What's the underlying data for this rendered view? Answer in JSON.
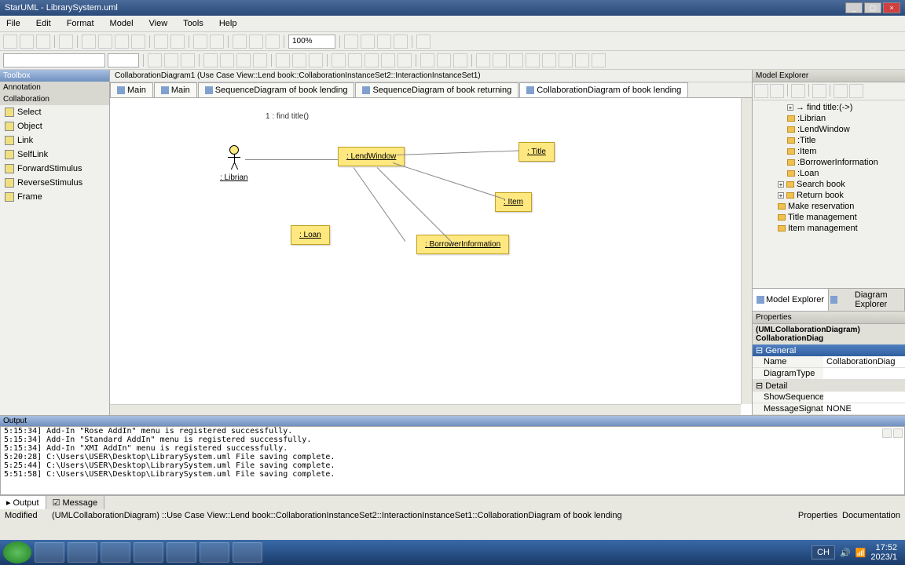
{
  "window": {
    "title": "StarUML - LibrarySystem.uml"
  },
  "menu": {
    "file": "File",
    "edit": "Edit",
    "format": "Format",
    "model": "Model",
    "view": "View",
    "tools": "Tools",
    "help": "Help"
  },
  "toolbar2": {
    "zoom": "100%"
  },
  "toolbox": {
    "title": "Toolbox",
    "groups": {
      "annotation": "Annotation",
      "collaboration": "Collaboration"
    },
    "items": {
      "select": "Select",
      "object": "Object",
      "link": "Link",
      "selflink": "SelfLink",
      "forward": "ForwardStimulus",
      "reverse": "ReverseStimulus",
      "frame": "Frame"
    }
  },
  "breadcrumb": "CollaborationDiagram1 (Use Case View::Lend book::CollaborationInstanceSet2::InteractionInstanceSet1)",
  "tabs": {
    "main1": "Main",
    "main2": "Main",
    "seq1": "SequenceDiagram of book lending",
    "seq2": "SequenceDiagram of book returning",
    "collab": "CollaborationDiagram of book lending"
  },
  "diagram": {
    "msg1": "1 : find title()",
    "actor": ": Librian",
    "lendwindow": ": LendWindow",
    "title": ": Title",
    "item": ": Item",
    "loan": ": Loan",
    "borrower": ": BorrowerInformation"
  },
  "explorer": {
    "title": "Model Explorer",
    "items": {
      "findtitle": "find title:(->)",
      "librian": ":Librian",
      "lendwindow": ":LendWindow",
      "titleobj": ":Title",
      "item": ":Item",
      "borrower": ":BorrowerInformation",
      "loan": ":Loan",
      "searchbook": "Search book",
      "returnbook": "Return book",
      "makeres": "Make reservation",
      "titlemgmt": "Title management",
      "itemmgmt": "Item management"
    },
    "tabs": {
      "model": "Model Explorer",
      "diagram": "Diagram Explorer"
    }
  },
  "properties": {
    "title": "Properties",
    "subject": "(UMLCollaborationDiagram) CollaborationDiag",
    "groups": {
      "general": "General",
      "detail": "Detail"
    },
    "rows": {
      "name_k": "Name",
      "name_v": "CollaborationDiag",
      "dtype_k": "DiagramType",
      "dtype_v": "",
      "showseq_k": "ShowSequenceNu",
      "showseq_v": "",
      "msgsig_k": "MessageSignatur",
      "msgsig_v": "NONE"
    }
  },
  "output": {
    "title": "Output",
    "lines": [
      "5:15:34]  Add-In \"Rose AddIn\" menu is registered successfully.",
      "5:15:34]  Add-In \"Standard AddIn\" menu is registered successfully.",
      "5:15:34]  Add-In \"XMI AddIn\" menu is registered successfully.",
      "5:20:28]  C:\\Users\\USER\\Desktop\\LibrarySystem.uml File saving complete.",
      "5:25:44]  C:\\Users\\USER\\Desktop\\LibrarySystem.uml File saving complete.",
      "5:51:58]  C:\\Users\\USER\\Desktop\\LibrarySystem.uml File saving complete."
    ],
    "tabs": {
      "output": "Output",
      "message": "Message"
    }
  },
  "status": {
    "modified": "Modified",
    "path": "(UMLCollaborationDiagram) ::Use Case View::Lend book::CollaborationInstanceSet2::InteractionInstanceSet1::CollaborationDiagram of book lending",
    "props": "Properties",
    "doc": "Documentation"
  },
  "taskbar": {
    "lang": "CH",
    "time": "17:52",
    "date": "2023/1"
  }
}
